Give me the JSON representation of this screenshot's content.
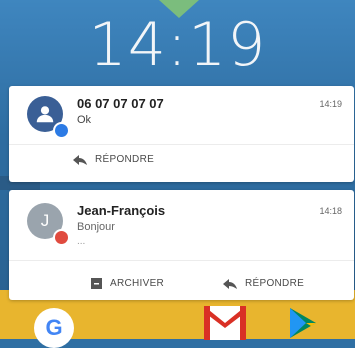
{
  "clock": {
    "time": "14:19"
  },
  "notifications": [
    {
      "sender": "06 07 07 07 07",
      "message": "Ok",
      "time": "14:19",
      "actions": {
        "reply": "RÉPONDRE"
      }
    },
    {
      "sender": "Jean-François",
      "message": "Bonjour",
      "more": "...",
      "time": "14:18",
      "avatar_letter": "J",
      "actions": {
        "archive": "ARCHIVER",
        "reply": "RÉPONDRE"
      }
    }
  ],
  "dock": {
    "google_letter": "G"
  },
  "icons": {
    "indicator": "expand-indicator-icon",
    "contact": "person-icon",
    "reply": "reply-arrow-icon",
    "archive": "archive-icon",
    "google": "google-icon",
    "gmail": "gmail-icon",
    "play": "play-store-icon"
  },
  "colors": {
    "wallpaper": "#2f6fa3",
    "indicator": "#7bbd7d",
    "avatar_1": "#3a5f96",
    "avatar_2": "#9aa4ad",
    "badge_sms": "#2c7be5",
    "badge_gmail": "#e04b3f",
    "dock_yellow": "#e8b52e"
  }
}
